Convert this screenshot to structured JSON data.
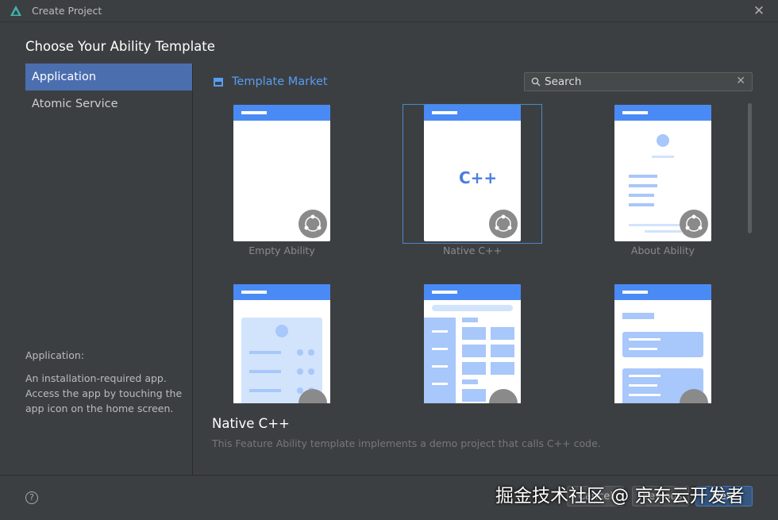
{
  "window": {
    "title": "Create Project",
    "close_glyph": "✕"
  },
  "heading": "Choose Your Ability Template",
  "sidebar": {
    "items": [
      {
        "label": "Application",
        "selected": true
      },
      {
        "label": "Atomic Service",
        "selected": false
      }
    ],
    "info_title": "Application:",
    "info_text": "An installation-required app. Access the app by touching the app icon on the home screen."
  },
  "market": {
    "label": "Template Market",
    "icon": "store-icon"
  },
  "search": {
    "placeholder": "Search",
    "value": "",
    "icon": "search-icon",
    "clear_glyph": "✕"
  },
  "templates": [
    {
      "label": "Empty Ability",
      "selected": false,
      "preview": "empty"
    },
    {
      "label": "Native C++",
      "selected": true,
      "preview": "cpp",
      "preview_text": "C++"
    },
    {
      "label": "About Ability",
      "selected": false,
      "preview": "about"
    },
    {
      "label": "",
      "selected": false,
      "preview": "profile"
    },
    {
      "label": "",
      "selected": false,
      "preview": "grid"
    },
    {
      "label": "",
      "selected": false,
      "preview": "cards"
    }
  ],
  "description": {
    "title": "Native C++",
    "text": "This Feature Ability template implements a demo project that calls C++ code."
  },
  "footer": {
    "help_glyph": "?",
    "buttons": {
      "cancel": "Cancel",
      "previous": "Previous",
      "next": "Next"
    }
  },
  "watermark": "掘金技术社区 @ 京东云开发者",
  "colors": {
    "accent": "#4b6eaf",
    "template_header": "#4a8af4",
    "link": "#589df6"
  }
}
